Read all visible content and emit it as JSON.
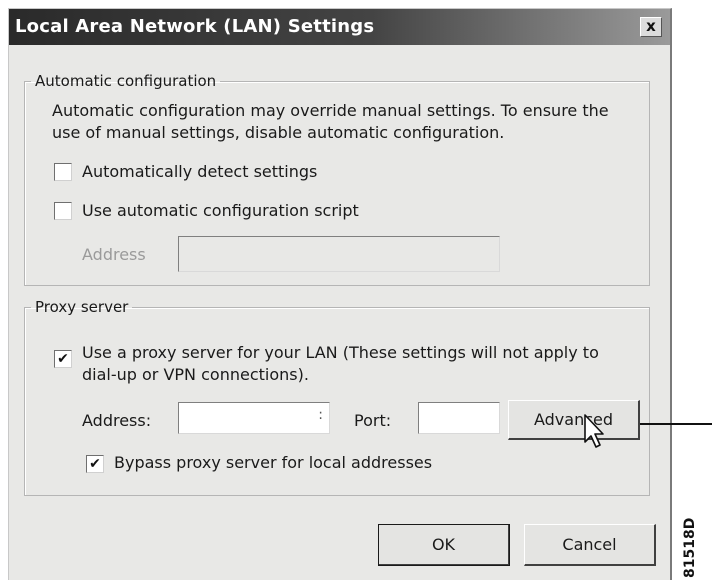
{
  "window": {
    "title": "Local Area Network (LAN) Settings",
    "close_label": "x"
  },
  "automatic_configuration": {
    "legend": "Automatic configuration",
    "description_line1": "Automatic configuration may override manual settings.  To ensure the",
    "description_line2": "use of manual settings, disable automatic configuration.",
    "auto_detect_label": "Automatically detect settings",
    "auto_detect_checked": false,
    "use_script_label": "Use automatic configuration script",
    "use_script_checked": false,
    "address_label": "Address",
    "address_value": ""
  },
  "proxy_server": {
    "legend": "Proxy server",
    "use_proxy_label_line1": "Use a proxy server for your LAN (These settings will not apply to",
    "use_proxy_label_line2": "dial-up or VPN connections).",
    "use_proxy_checked": true,
    "address_label": "Address:",
    "address_value": "",
    "address_suffix": ":",
    "port_label": "Port:",
    "port_value": "",
    "advanced_label": "Advanced",
    "bypass_label": "Bypass proxy server for local addresses",
    "bypass_checked": true
  },
  "buttons": {
    "ok_label": "OK",
    "cancel_label": "Cancel"
  },
  "figure_id": "81518D",
  "check_glyph": "✔"
}
